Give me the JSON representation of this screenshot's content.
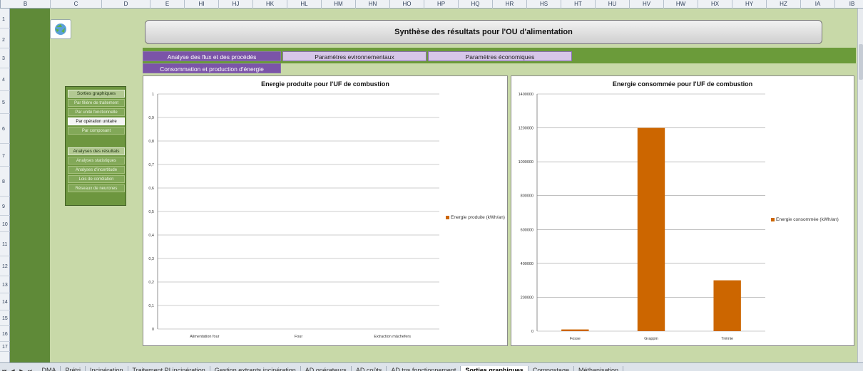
{
  "column_headers": [
    "B",
    "C",
    "D",
    "E",
    "HI",
    "HJ",
    "HK",
    "HL",
    "HM",
    "HN",
    "HO",
    "HP",
    "HQ",
    "HR",
    "HS",
    "HT",
    "HU",
    "HV",
    "HW",
    "HX",
    "HY",
    "HZ",
    "IA",
    "IB",
    "IC",
    "ID",
    "IE"
  ],
  "row_headers": [
    "1",
    "2",
    "3",
    "4",
    "5",
    "6",
    "7",
    "8",
    "9",
    "10",
    "11",
    "12",
    "13",
    "14",
    "15",
    "16",
    "17"
  ],
  "page_title": "Synthèse des résultats pour l'OU d'alimentation",
  "tabs": [
    {
      "label": "Analyse des flux et des procédés"
    },
    {
      "label": "Paramètres evironnementaux"
    },
    {
      "label": "Paramètres économiques"
    },
    {
      "label": "Consommation et production d'énergie"
    }
  ],
  "side_panel": {
    "section1": "Sorties graphiques",
    "buttons1": [
      "Par filière de traitement",
      "Par unité fonctionnelle",
      "Par opération unitaire",
      "Par composant"
    ],
    "section2": "Analyses des résultats",
    "buttons2": [
      "Analyses statistiques",
      "Analyses d'incertitude",
      "Lois de corrélation",
      "Réseaux de neurones"
    ]
  },
  "colors": {
    "bar": "#cc6600",
    "active_tab": "#7b54a8",
    "sheet_bg": "#c8d9a8",
    "green_strip": "#5f8a38"
  },
  "chart_data": [
    {
      "type": "bar",
      "title": "Energie produite pour l'UF de combustion",
      "categories": [
        "Alimentation four",
        "Four",
        "Extraction mâchefers"
      ],
      "series": [
        {
          "name": "Energie produite (kWh/an)",
          "values": [
            0,
            0,
            0
          ]
        }
      ],
      "ylim": [
        0,
        1
      ],
      "yticks": [
        "0",
        "0,1",
        "0,2",
        "0,3",
        "0,4",
        "0,5",
        "0,6",
        "0,7",
        "0,8",
        "0,9",
        "1"
      ],
      "grid": true,
      "legend": "right"
    },
    {
      "type": "bar",
      "title": "Energie consommée pour l'UF de combustion",
      "categories": [
        "Fosse",
        "Grappin",
        "Trémie"
      ],
      "series": [
        {
          "name": "Energie consommée (kWh/an)",
          "values": [
            10000,
            1200000,
            300000
          ]
        }
      ],
      "ylim": [
        0,
        1400000
      ],
      "yticks": [
        "0",
        "200000",
        "400000",
        "600000",
        "800000",
        "1000000",
        "1200000",
        "1400000"
      ],
      "grid": true,
      "legend": "right"
    }
  ],
  "sheet_tabs": [
    "DMA",
    "Prétri",
    "Incinération",
    "Traitement PI incinération",
    "Gestion extrants incinération",
    "AD opérateurs",
    "AD coûts",
    "AD tps fonctionnement",
    "Sorties graphiques",
    "Compostage",
    "Méthanisation"
  ],
  "active_sheet_tab": "Sorties graphiques"
}
